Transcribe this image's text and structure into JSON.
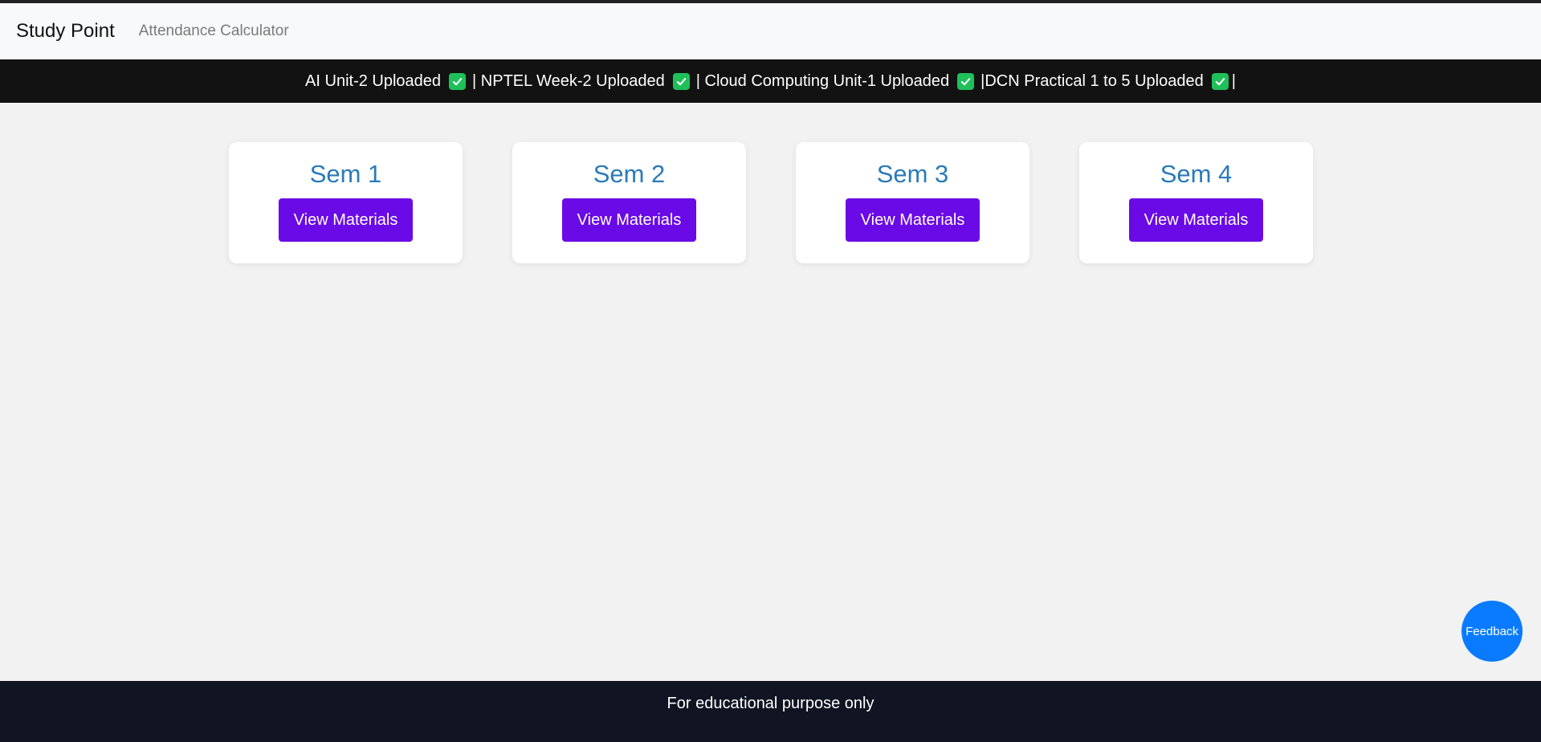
{
  "navbar": {
    "brand": "Study Point",
    "links": [
      {
        "label": "Attendance Calculator"
      }
    ]
  },
  "ticker": {
    "items": [
      {
        "text": "AI Unit-2 Uploaded",
        "icon": "check-icon"
      },
      {
        "text": "| NPTEL Week-2 Uploaded",
        "icon": "check-icon"
      },
      {
        "text": "| Cloud Computing Unit-1 Uploaded",
        "icon": "check-icon"
      },
      {
        "text": "|DCN Practical 1 to 5 Uploaded",
        "icon": "check-icon"
      }
    ],
    "trailing": "|",
    "check_color": "#1fc05a"
  },
  "semesters": [
    {
      "title": "Sem 1",
      "button_label": "View Materials"
    },
    {
      "title": "Sem 2",
      "button_label": "View Materials"
    },
    {
      "title": "Sem 3",
      "button_label": "View Materials"
    },
    {
      "title": "Sem 4",
      "button_label": "View Materials"
    }
  ],
  "feedback": {
    "label": "Feedback"
  },
  "footer": {
    "text": "For educational purpose only"
  },
  "colors": {
    "accent_button": "#6a0ae6",
    "card_title": "#2a7ab8",
    "feedback_button": "#0a7bff",
    "ticker_bg": "#121212",
    "footer_bg": "#111422"
  }
}
